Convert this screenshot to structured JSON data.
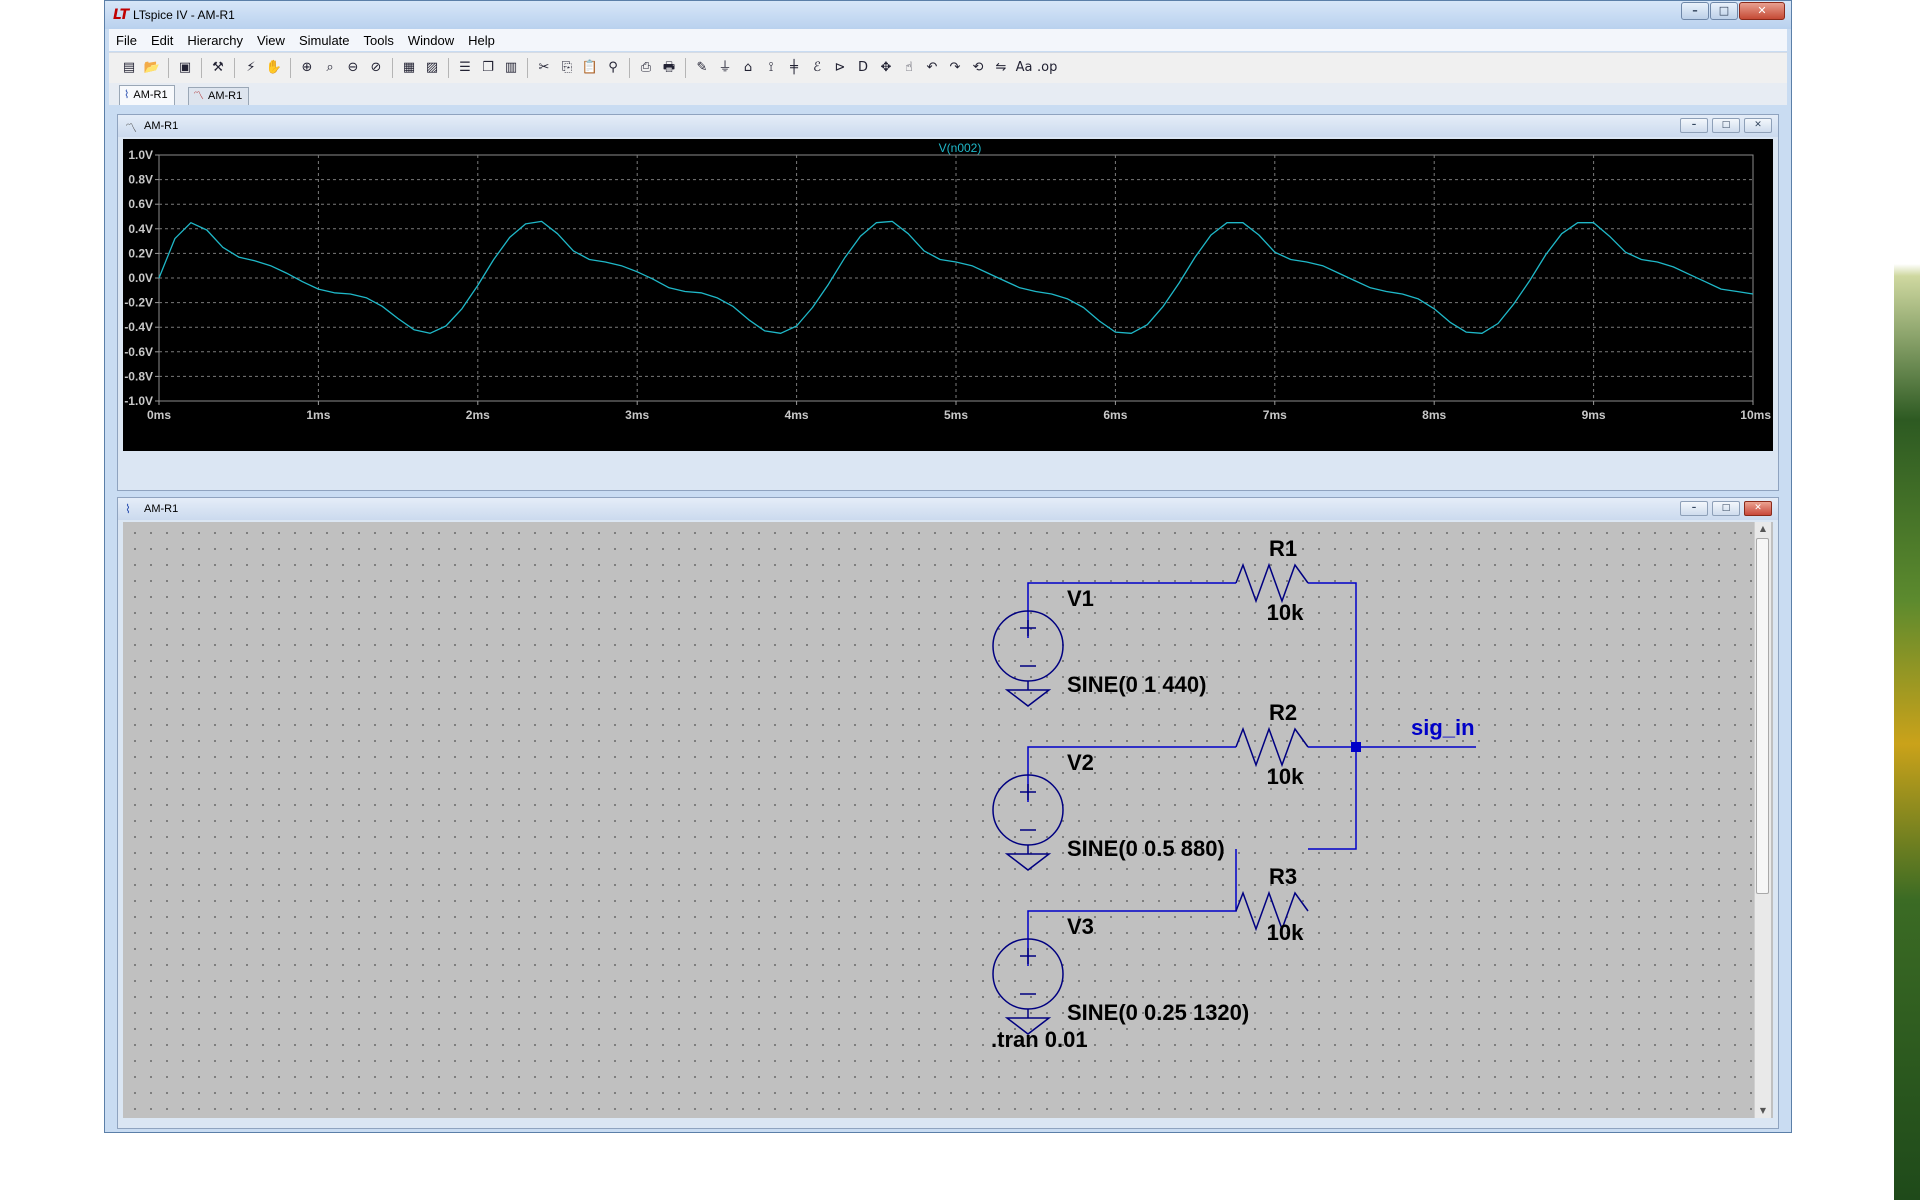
{
  "app": {
    "title": "LTspice IV - AM-R1",
    "window_buttons": [
      "–",
      "□",
      "✕"
    ]
  },
  "menu": [
    "File",
    "Edit",
    "Hierarchy",
    "View",
    "Simulate",
    "Tools",
    "Window",
    "Help"
  ],
  "toolbar_icons": [
    "new-schematic-icon",
    "open-icon",
    "save-icon",
    "control-panel-icon",
    "run-icon",
    "halt-icon",
    "zoom-in-icon",
    "zoom-to-fit-icon",
    "zoom-out-icon",
    "zoom-cancel-icon",
    "autoscale-icon",
    "dc-op-icon",
    "tile-horizontal-icon",
    "cascade-icon",
    "tile-vertical-icon",
    "cut-icon",
    "copy-icon",
    "paste-icon",
    "find-icon",
    "print-preview-icon",
    "print-icon",
    "draw-wire-icon",
    "ground-icon",
    "label-net-icon",
    "resistor-icon",
    "capacitor-icon",
    "inductor-icon",
    "diode-icon",
    "component-icon",
    "move-icon",
    "drag-icon",
    "undo-icon",
    "redo-icon",
    "rotate-icon",
    "mirror-icon",
    "text-icon",
    "spice-directive-icon"
  ],
  "tabs": [
    {
      "label": "AM-R1",
      "icon": "schematic-icon"
    },
    {
      "label": "AM-R1",
      "icon": "waveform-icon"
    }
  ],
  "plot_window": {
    "title": "AM-R1",
    "mdi_buttons": [
      "–",
      "□",
      "✕"
    ]
  },
  "schematic_window": {
    "title": "AM-R1",
    "mdi_buttons": [
      "–",
      "□",
      "✕"
    ]
  },
  "chart_data": {
    "type": "line",
    "title": "V(n002)",
    "xlabel": "",
    "ylabel": "",
    "x_unit": "ms",
    "y_unit": "V",
    "xlim": [
      0,
      10
    ],
    "ylim": [
      -1.0,
      1.0
    ],
    "x_ticks": [
      "0ms",
      "1ms",
      "2ms",
      "3ms",
      "4ms",
      "5ms",
      "6ms",
      "7ms",
      "8ms",
      "9ms",
      "10ms"
    ],
    "y_ticks": [
      "1.0V",
      "0.8V",
      "0.6V",
      "0.4V",
      "0.2V",
      "0.0V",
      "-0.2V",
      "-0.4V",
      "-0.6V",
      "-0.8V",
      "-1.0V"
    ],
    "grid": true,
    "series": [
      {
        "name": "V(n002)",
        "color": "#1fb8c8",
        "x": [
          0,
          0.1,
          0.2,
          0.3,
          0.4,
          0.5,
          0.6,
          0.7,
          0.8,
          0.9,
          1.0,
          1.1,
          1.2,
          1.3,
          1.4,
          1.5,
          1.6,
          1.7,
          1.8,
          1.9,
          2.0,
          2.1,
          2.2,
          2.3,
          2.4,
          2.5,
          2.6,
          2.7,
          2.8,
          2.9,
          3.0,
          3.1,
          3.2,
          3.3,
          3.4,
          3.5,
          3.6,
          3.7,
          3.8,
          3.9,
          4.0,
          4.1,
          4.2,
          4.3,
          4.4,
          4.5,
          4.6,
          4.7,
          4.8,
          4.9,
          5.0,
          5.1,
          5.2,
          5.3,
          5.4,
          5.5,
          5.6,
          5.7,
          5.8,
          5.9,
          6.0,
          6.1,
          6.2,
          6.3,
          6.4,
          6.5,
          6.6,
          6.7,
          6.8,
          6.9,
          7.0,
          7.1,
          7.2,
          7.3,
          7.4,
          7.5,
          7.6,
          7.7,
          7.8,
          7.9,
          8.0,
          8.1,
          8.2,
          8.3,
          8.4,
          8.5,
          8.6,
          8.7,
          8.8,
          8.9,
          9.0,
          9.1,
          9.2,
          9.3,
          9.4,
          9.5,
          9.6,
          9.7,
          9.8,
          9.9,
          10.0
        ],
        "y": [
          0.0,
          0.32,
          0.45,
          0.39,
          0.25,
          0.17,
          0.14,
          0.1,
          0.04,
          -0.03,
          -0.09,
          -0.12,
          -0.13,
          -0.16,
          -0.23,
          -0.33,
          -0.42,
          -0.45,
          -0.39,
          -0.25,
          -0.06,
          0.15,
          0.33,
          0.44,
          0.46,
          0.36,
          0.22,
          0.15,
          0.13,
          0.1,
          0.05,
          -0.01,
          -0.08,
          -0.11,
          -0.12,
          -0.16,
          -0.23,
          -0.34,
          -0.43,
          -0.45,
          -0.39,
          -0.24,
          -0.05,
          0.16,
          0.34,
          0.45,
          0.46,
          0.36,
          0.22,
          0.15,
          0.13,
          0.1,
          0.04,
          -0.02,
          -0.08,
          -0.11,
          -0.13,
          -0.17,
          -0.24,
          -0.35,
          -0.44,
          -0.45,
          -0.38,
          -0.23,
          -0.04,
          0.17,
          0.35,
          0.45,
          0.45,
          0.35,
          0.21,
          0.15,
          0.13,
          0.1,
          0.04,
          -0.02,
          -0.08,
          -0.11,
          -0.13,
          -0.17,
          -0.25,
          -0.36,
          -0.44,
          -0.45,
          -0.37,
          -0.21,
          -0.02,
          0.19,
          0.36,
          0.45,
          0.45,
          0.34,
          0.21,
          0.15,
          0.13,
          0.09,
          0.03,
          -0.03,
          -0.09,
          -0.11,
          -0.13
        ]
      }
    ]
  },
  "schematic": {
    "components": [
      {
        "ref": "V1",
        "value": "SINE(0 1 440)"
      },
      {
        "ref": "V2",
        "value": "SINE(0 0.5 880)"
      },
      {
        "ref": "V3",
        "value": "SINE(0 0.25 1320)"
      },
      {
        "ref": "R1",
        "value": "10k"
      },
      {
        "ref": "R2",
        "value": "10k"
      },
      {
        "ref": "R3",
        "value": "10k"
      }
    ],
    "net_label": "sig_in",
    "directive": ".tran 0.01",
    "colors": {
      "wire": "#0000c8",
      "net_label": "#0000c8",
      "component": "#000080",
      "text": "#000000"
    }
  }
}
